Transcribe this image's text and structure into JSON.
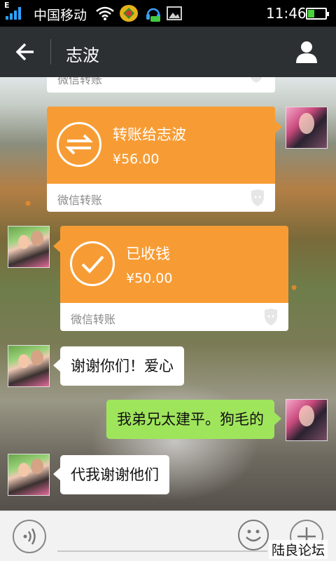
{
  "status_bar": {
    "indicator": "E",
    "carrier": "中国移动",
    "time": "11:46",
    "battery_level": 0.35,
    "icons": [
      "signal-icon",
      "wifi-icon",
      "game-app-icon",
      "chat-notify-icon",
      "image-notify-icon",
      "battery-icon"
    ]
  },
  "header": {
    "title": "志波",
    "back_icon": "arrow-left-icon",
    "profile_icon": "person-icon"
  },
  "messages": [
    {
      "type": "transfer-partial",
      "side": "right",
      "label": "微信转账"
    },
    {
      "type": "transfer",
      "side": "right",
      "icon": "transfer-arrows-icon",
      "title": "转账给志波",
      "amount": "¥56.00",
      "label": "微信转账"
    },
    {
      "type": "transfer",
      "side": "left",
      "icon": "checkmark-icon",
      "title": "已收钱",
      "amount": "¥50.00",
      "label": "微信转账"
    },
    {
      "type": "text",
      "side": "left",
      "text": "谢谢你们！爱心"
    },
    {
      "type": "text",
      "side": "right",
      "text": "我弟兄太建平。狗毛的"
    },
    {
      "type": "text",
      "side": "left",
      "text": "代我谢谢他们"
    }
  ],
  "input_bar": {
    "voice_icon": "voice-icon",
    "emoji_icon": "smiley-icon",
    "plus_icon": "plus-icon"
  },
  "watermark": "陆良论坛",
  "colors": {
    "transfer_orange": "#f79c34",
    "sent_green": "#9fe55c",
    "header_bg": "#2c3033"
  }
}
